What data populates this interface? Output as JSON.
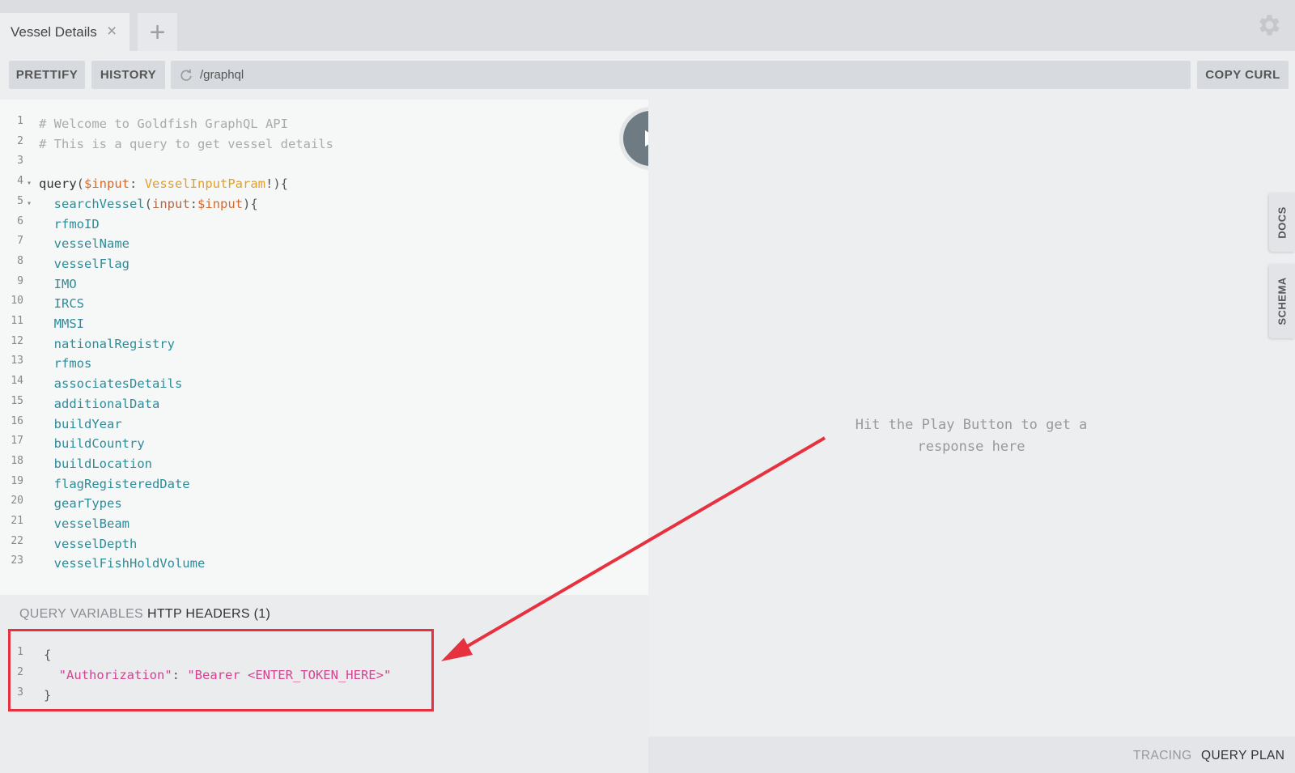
{
  "tabs": [
    {
      "label": "Vessel Details"
    }
  ],
  "toolbar": {
    "prettify": "PRETTIFY",
    "history": "HISTORY",
    "endpoint": "/graphql",
    "copy_curl": "COPY CURL"
  },
  "editor": {
    "lines": [
      {
        "n": "1",
        "text": "# Welcome to Goldfish GraphQL API"
      },
      {
        "n": "2",
        "text": "# This is a query to get vessel details"
      },
      {
        "n": "3",
        "text": ""
      },
      {
        "n": "4",
        "text": "query($input: VesselInputParam!){"
      },
      {
        "n": "5",
        "text": "  searchVessel(input:$input){"
      },
      {
        "n": "6",
        "text": "  rfmoID"
      },
      {
        "n": "7",
        "text": "  vesselName"
      },
      {
        "n": "8",
        "text": "  vesselFlag"
      },
      {
        "n": "9",
        "text": "  IMO"
      },
      {
        "n": "10",
        "text": "  IRCS"
      },
      {
        "n": "11",
        "text": "  MMSI"
      },
      {
        "n": "12",
        "text": "  nationalRegistry"
      },
      {
        "n": "13",
        "text": "  rfmos"
      },
      {
        "n": "14",
        "text": "  associatesDetails"
      },
      {
        "n": "15",
        "text": "  additionalData"
      },
      {
        "n": "16",
        "text": "  buildYear"
      },
      {
        "n": "17",
        "text": "  buildCountry"
      },
      {
        "n": "18",
        "text": "  buildLocation"
      },
      {
        "n": "19",
        "text": "  flagRegisteredDate"
      },
      {
        "n": "20",
        "text": "  gearTypes"
      },
      {
        "n": "21",
        "text": "  vesselBeam"
      },
      {
        "n": "22",
        "text": "  vesselDepth"
      },
      {
        "n": "23",
        "text": "  vesselFishHoldVolume"
      }
    ]
  },
  "variables": {
    "tabs": {
      "query_variables": "QUERY VARIABLES",
      "http_headers": "HTTP HEADERS (1)"
    },
    "lines": [
      {
        "n": "1",
        "text": "{"
      },
      {
        "n": "2",
        "text": "  \"Authorization\": \"Bearer <ENTER_TOKEN_HERE>\""
      },
      {
        "n": "3",
        "text": "}"
      }
    ]
  },
  "result": {
    "hint": "Hit the Play Button to get a response here"
  },
  "side_tabs": {
    "docs": "DOCS",
    "schema": "SCHEMA"
  },
  "footer": {
    "tracing": "TRACING",
    "query_plan": "QUERY PLAN"
  },
  "colors": {
    "annotation": "#e8313f",
    "play": "#6e7b83"
  }
}
